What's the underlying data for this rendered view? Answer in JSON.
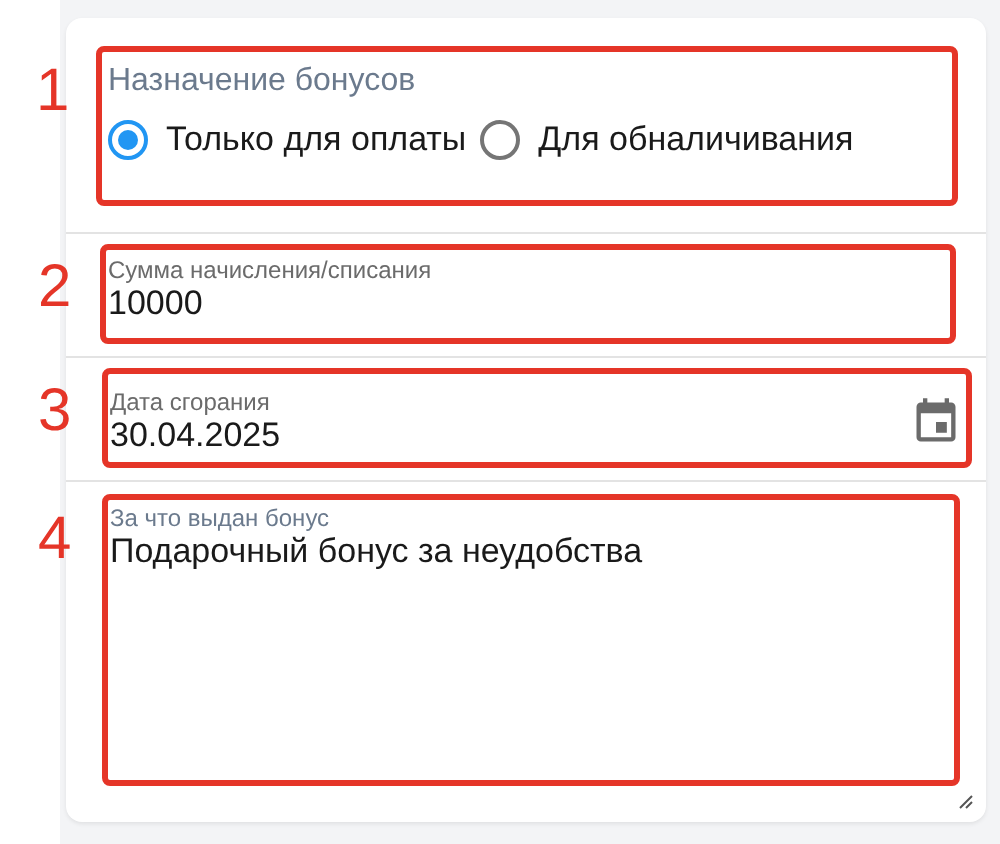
{
  "sections": [
    {
      "kind": "radio-group",
      "annotation": "1",
      "label": "Назначение бонусов",
      "options": [
        {
          "label": "Только для оплаты",
          "selected": true
        },
        {
          "label": "Для обналичивания",
          "selected": false
        }
      ]
    },
    {
      "kind": "input",
      "annotation": "2",
      "label": "Сумма начисления/списания",
      "value": "10000"
    },
    {
      "kind": "date",
      "annotation": "3",
      "label": "Дата сгорания",
      "value": "30.04.2025"
    },
    {
      "kind": "textarea",
      "annotation": "4",
      "label": "За что выдан бонус",
      "value": "Подарочный бонус за неудобства"
    }
  ]
}
